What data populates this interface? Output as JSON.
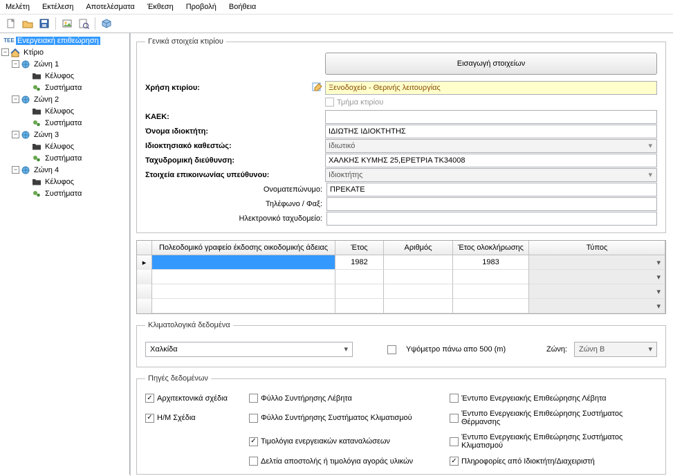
{
  "menu": {
    "study": "Μελέτη",
    "exec": "Εκτέλεση",
    "results": "Αποτελέσματα",
    "report": "Έκθεση",
    "view": "Προβολή",
    "help": "Βοήθεια"
  },
  "tree": {
    "root_tag": "ΤΕΕ",
    "root": "Ενεργειακή επιθεώρηση",
    "building": "Κτίριο",
    "zones": [
      {
        "label": "Ζώνη 1",
        "envelope": "Κέλυφος",
        "systems": "Συστήματα"
      },
      {
        "label": "Ζώνη 2",
        "envelope": "Κέλυφος",
        "systems": "Συστήματα"
      },
      {
        "label": "Ζώνη 3",
        "envelope": "Κέλυφος",
        "systems": "Συστήματα"
      },
      {
        "label": "Ζώνη 4",
        "envelope": "Κέλυφος",
        "systems": "Συστήματα"
      }
    ]
  },
  "general": {
    "legend": "Γενικά στοιχεία κτιρίου",
    "import_btn": "Εισαγωγή στοιχείων",
    "use_label": "Χρήση κτιρίου:",
    "use_value": "Ξενοδοχείο - Θερινής λειτουργίας",
    "part_label": "Τμήμα κτιρίου",
    "kaek_label": "ΚΑΕΚ:",
    "owner_label": "Όνομα ιδιοκτήτη:",
    "owner_value": "ΙΔΙΩΤΗΣ ΙΔΙΟΚΤΗΤΗΣ",
    "ownstat_label": "Ιδιοκτησιακό καθεστώς:",
    "ownstat_value": "Ιδιωτικό",
    "addr_label": "Ταχυδρομική διεύθυνση:",
    "addr_value": "ΧΑΛΚΗΣ ΚΥΜΗΣ 25,ΕΡΕΤΡΙΑ ΤΚ34008",
    "contact_label": "Στοιχεία επικοινωνίας υπεύθυνου:",
    "contact_value": "Ιδιοκτήτης",
    "name_label": "Ονοματεπώνυμο:",
    "name_value": "ΠΡΕΚΑΤΕ",
    "phone_label": "Τηλέφωνο / Φαξ:",
    "email_label": "Ηλεκτρονικό ταχυδομείο:"
  },
  "grid": {
    "h1": "Πολεοδομικό γραφείο έκδοσης οικοδομικής άδειας",
    "h2": "Έτος",
    "h3": "Αριθμός",
    "h4": "Έτος ολοκλήρωσης",
    "h5": "Τύπος",
    "rows": [
      {
        "year": "1982",
        "number": "",
        "comp": "1983"
      },
      {
        "year": "",
        "number": "",
        "comp": ""
      },
      {
        "year": "",
        "number": "",
        "comp": ""
      },
      {
        "year": "",
        "number": "",
        "comp": ""
      }
    ]
  },
  "climate": {
    "legend": "Κλιματολογικά δεδομένα",
    "city": "Χαλκίδα",
    "alt_label": "Υψόμετρο πάνω απο 500 (m)",
    "zone_label": "Ζώνη:",
    "zone_value": "Ζώνη Β"
  },
  "sources": {
    "legend": "Πηγές δεδομένων",
    "s1": "Αρχιτεκτονικά σχέδια",
    "s2": "Η/Μ Σχέδια",
    "s3": "Φύλλο Συντήρησης Λέβητα",
    "s4": "Φύλλο Συντήρησης Συστήματος Κλιματισμού",
    "s5": "Τιμολόγια ενεργειακών καταναλώσεων",
    "s6": "Δελτία αποστολής ή τιμολόγια αγοράς υλικών",
    "s7": "Έντυπο Ενεργειακής Επιθεώρησης Λέβητα",
    "s8": "Έντυπο Ενεργειακής Επιθεώρησης Συστήματος Θέρμανσης",
    "s9": "Έντυπο Ενεργειακής Επιθεώρησης Συστήματος Κλιματισμού",
    "s10": "Πληροφορίες από Ιδιοκτήτη/Διαχειριστή"
  }
}
